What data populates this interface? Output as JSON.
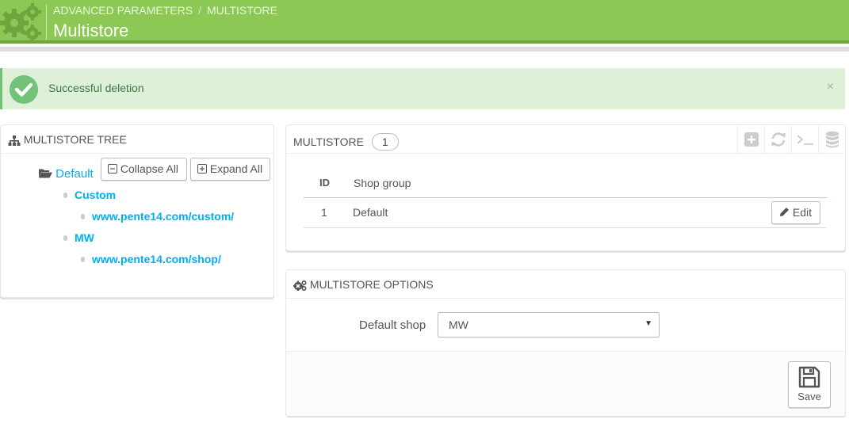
{
  "header": {
    "breadcrumb": [
      "ADVANCED PARAMETERS",
      "MULTISTORE"
    ],
    "breadcrumb_sep": "/",
    "title": "Multistore",
    "icon": "gears-icon",
    "bg_color": "#8bc954"
  },
  "alert": {
    "icon": "check-circle-icon",
    "message": "Successful deletion",
    "close": "×",
    "bg_color": "#dff0d8"
  },
  "tree": {
    "heading": "MULTISTORE TREE",
    "heading_icon": "sitemap-icon",
    "root": "Default",
    "root_icon": "folder-open-icon",
    "collapse_label": "Collapse All",
    "expand_label": "Expand All",
    "groups": [
      {
        "name": "Custom",
        "shops": [
          "www.pente14.com/custom/"
        ]
      },
      {
        "name": "MW",
        "shops": [
          "www.pente14.com/shop/"
        ]
      }
    ]
  },
  "multistore": {
    "heading": "MULTISTORE",
    "count": "1",
    "toolbar_icons": [
      "add-icon",
      "refresh-icon",
      "sql-query-icon",
      "database-icon"
    ],
    "columns": [
      "ID",
      "Shop group"
    ],
    "rows": [
      {
        "id": "1",
        "shop_group": "Default",
        "action": "Edit"
      }
    ]
  },
  "options": {
    "heading": "MULTISTORE OPTIONS",
    "heading_icon": "cogs-icon",
    "default_shop_label": "Default shop",
    "default_shop_value": "MW",
    "save_label": "Save"
  }
}
